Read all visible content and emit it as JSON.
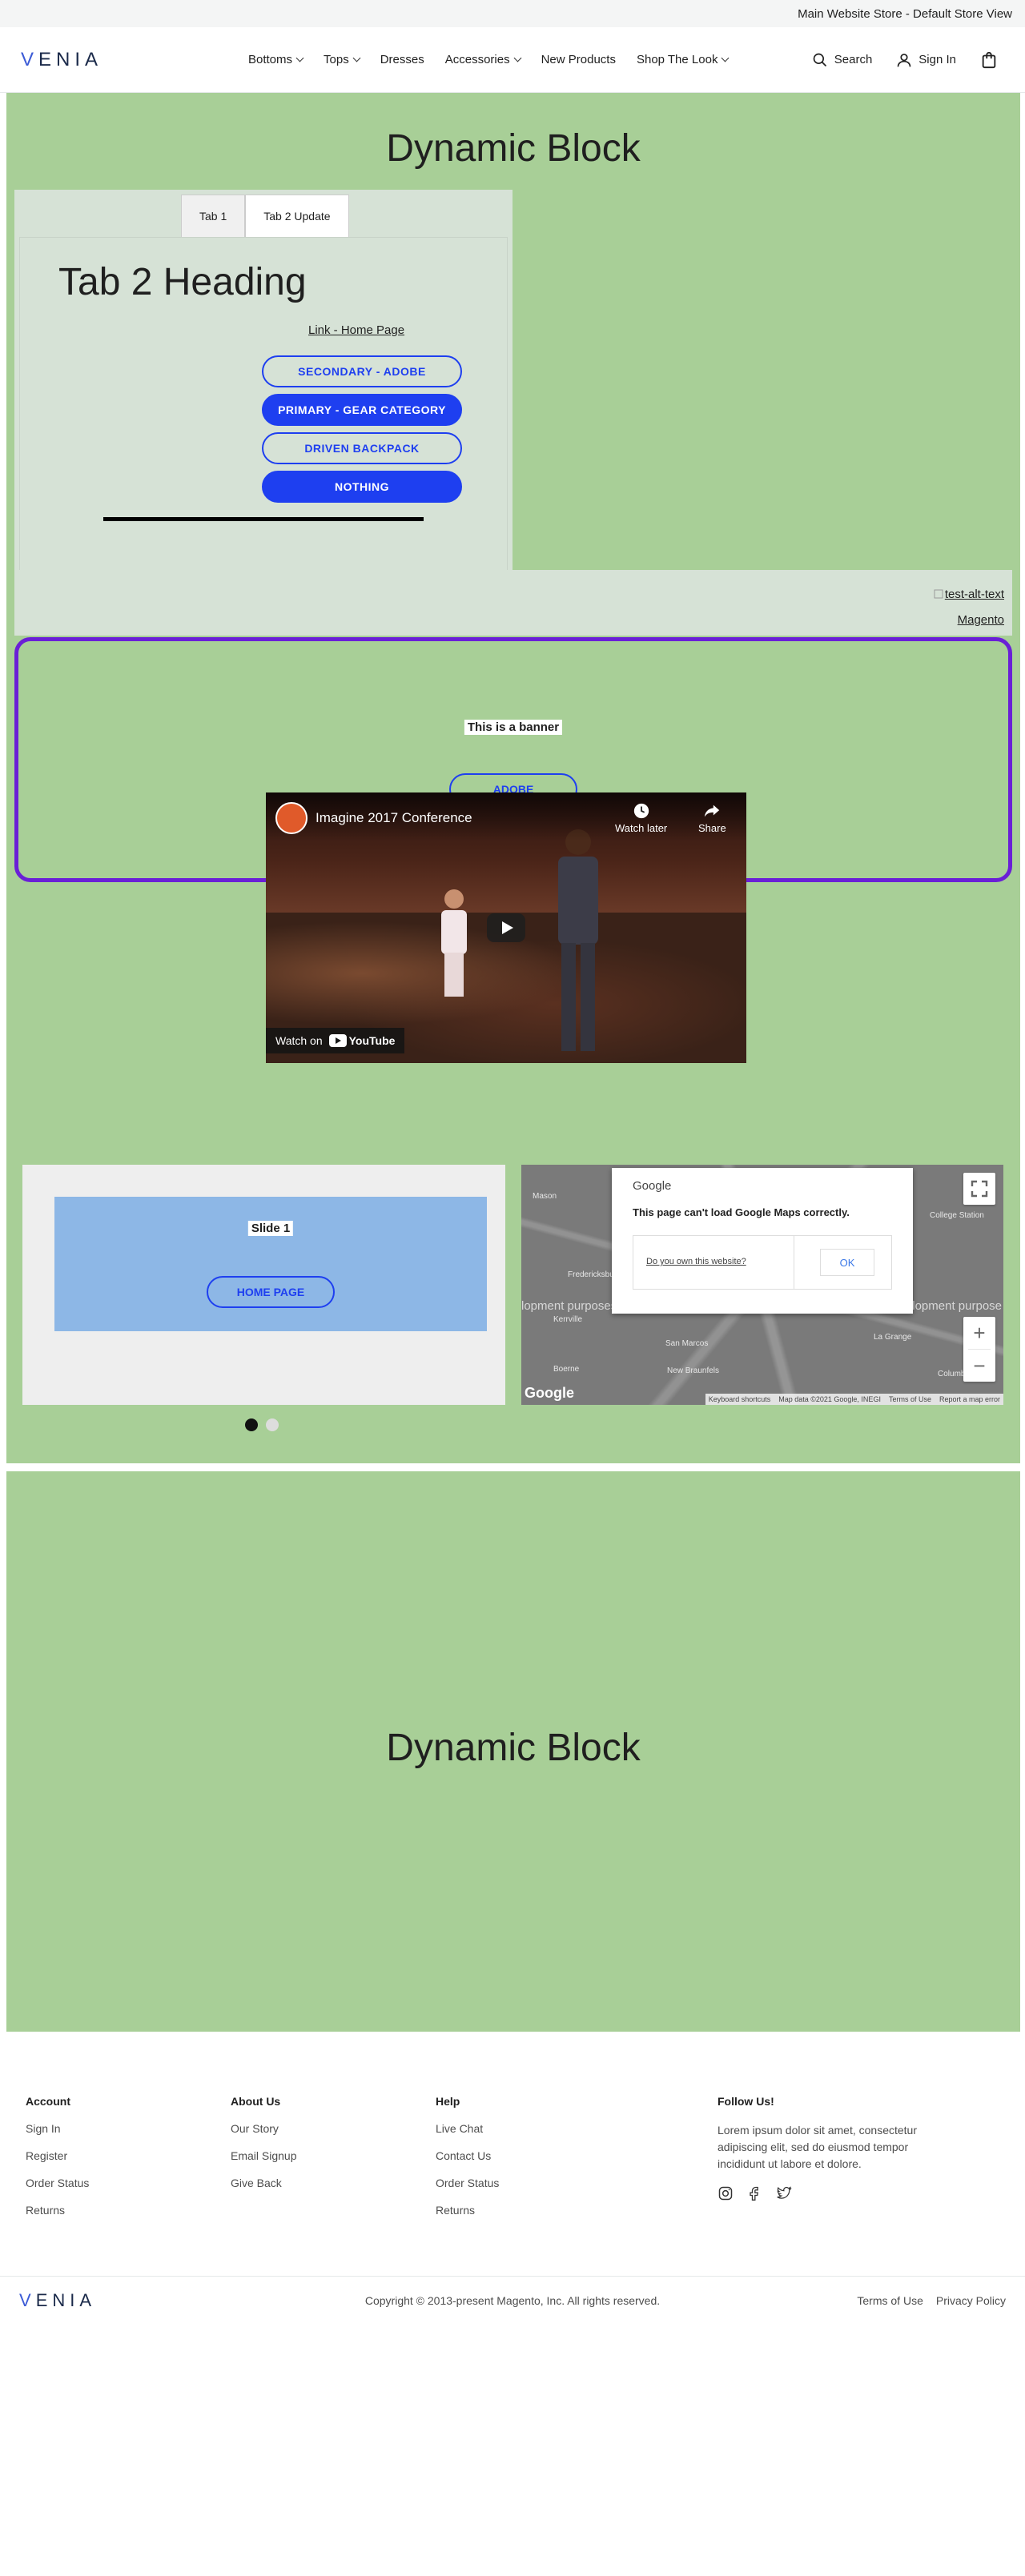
{
  "topbar": {
    "store_view": "Main Website Store - Default Store View"
  },
  "header": {
    "logo": "ENIA",
    "logo_first": "V",
    "nav": [
      {
        "label": "Bottoms",
        "dropdown": true
      },
      {
        "label": "Tops",
        "dropdown": true
      },
      {
        "label": "Dresses",
        "dropdown": false
      },
      {
        "label": "Accessories",
        "dropdown": true
      },
      {
        "label": "New Products",
        "dropdown": false
      },
      {
        "label": "Shop The Look",
        "dropdown": true
      }
    ],
    "search_label": "Search",
    "signin_label": "Sign In"
  },
  "dynamic_block_1": {
    "title": "Dynamic Block",
    "tabs": [
      {
        "label": "Tab 1"
      },
      {
        "label": "Tab 2 Update"
      }
    ],
    "tab_heading": "Tab 2 Heading",
    "home_link": "Link - Home Page",
    "buttons": [
      {
        "label": "SECONDARY - ADOBE",
        "style": "secondary"
      },
      {
        "label": "PRIMARY - GEAR CATEGORY",
        "style": "primary"
      },
      {
        "label": "DRIVEN BACKPACK",
        "style": "secondary"
      },
      {
        "label": "NOTHING",
        "style": "primary"
      }
    ],
    "image_alt": "test-alt-text",
    "image_link": "Magento",
    "banner": {
      "message": "This is a banner",
      "button": "ADOBE"
    },
    "video": {
      "title": "Imagine 2017 Conference",
      "watch_later": "Watch later",
      "share": "Share",
      "watch_on": "Watch on",
      "youtube": "YouTube"
    },
    "slider": {
      "slide_title": "Slide 1",
      "slide_button": "HOME PAGE",
      "dots": 2,
      "active_dot": 0
    },
    "map": {
      "dialog_brand": "Google",
      "error": "This page can't load Google Maps correctly.",
      "own_link": "Do you own this website?",
      "ok": "OK",
      "dev_text_left": "lopment purposes",
      "dev_text_right": "development purpose",
      "google_mark": "Google",
      "attribution": [
        "Keyboard shortcuts",
        "Map data ©2021 Google, INEGI",
        "Terms of Use",
        "Report a map error"
      ],
      "cities": [
        "Mason",
        "Fredericksburg",
        "Kerrville",
        "Boerne",
        "San Marcos",
        "New Braunfels",
        "La Grange",
        "College Station",
        "Columbus"
      ]
    }
  },
  "dynamic_block_2": {
    "title": "Dynamic Block"
  },
  "footer": {
    "columns": [
      {
        "heading": "Account",
        "links": [
          "Sign In",
          "Register",
          "Order Status",
          "Returns"
        ]
      },
      {
        "heading": "About Us",
        "links": [
          "Our Story",
          "Email Signup",
          "Give Back"
        ]
      },
      {
        "heading": "Help",
        "links": [
          "Live Chat",
          "Contact Us",
          "Order Status",
          "Returns"
        ]
      }
    ],
    "follow": {
      "heading": "Follow Us!",
      "text": "Lorem ipsum dolor sit amet, consectetur adipiscing elit, sed do eiusmod tempor incididunt ut labore et dolore."
    },
    "logo": "ENIA",
    "logo_first": "V",
    "copyright": "Copyright © 2013-present Magento, Inc. All rights reserved.",
    "legal": [
      "Terms of Use",
      "Privacy Policy"
    ]
  },
  "colors": {
    "accent": "#1e3ff0",
    "dynamic_bg": "#a8cf97",
    "banner_border": "#6a1fd6",
    "slide_bg": "#8db7e6"
  }
}
